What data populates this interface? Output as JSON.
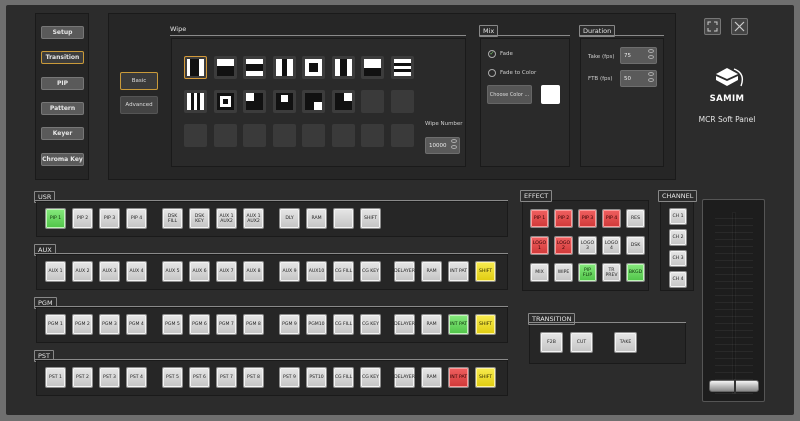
{
  "nav": [
    "Setup",
    "Transition",
    "PIP",
    "Pattern",
    "Keyer",
    "Chroma Key"
  ],
  "nav_active": 1,
  "wipe": {
    "title": "Wipe",
    "tabs": [
      "Basic",
      "Advanced"
    ],
    "number_label": "Wipe Number",
    "number_value": "10000"
  },
  "mix": {
    "title": "Mix",
    "fade": "Fade",
    "fade_to_color": "Fade to Color",
    "choose_color": "Choose Color ..."
  },
  "duration": {
    "title": "Duration",
    "take_label": "Take (fps)",
    "take_value": "75",
    "ftb_label": "FTB (fps)",
    "ftb_value": "50"
  },
  "brand": {
    "name": "SAMIM",
    "product": "MCR Soft Panel"
  },
  "usr": {
    "title": "USR",
    "buttons": [
      "PIP 1",
      "PIP 2",
      "PIP 3",
      "PIP 4",
      "DSK FILL",
      "DSK KEY",
      "AUX 1 AUX2",
      "AUX 1 AUX2",
      "DLY",
      "RAM",
      "",
      "SHIFT"
    ]
  },
  "aux": {
    "title": "AUX",
    "buttons": [
      "AUX 1",
      "AUX 2",
      "AUX 3",
      "AUX 4",
      "AUX 5",
      "AUX 6",
      "AUX 7",
      "AUX 8",
      "AUX 9",
      "AUX10",
      "CG FILL",
      "CG KEY",
      "DELAYER",
      "RAM",
      "INT PAT",
      "SHIFT"
    ]
  },
  "pgm": {
    "title": "PGM",
    "buttons": [
      "PGM 1",
      "PGM 2",
      "PGM 3",
      "PGM 4",
      "PGM 5",
      "PGM 6",
      "PGM 7",
      "PGM 8",
      "PGM 9",
      "PGM10",
      "CG FILL",
      "CG KEY",
      "DELAYER",
      "RAM",
      "INT PAT",
      "SHIFT"
    ]
  },
  "pst": {
    "title": "PST",
    "buttons": [
      "PST 1",
      "PST 2",
      "PST 3",
      "PST 4",
      "PST 5",
      "PST 6",
      "PST 7",
      "PST 8",
      "PST 9",
      "PST10",
      "CG FILL",
      "CG KEY",
      "DELAYER",
      "RAM",
      "INT PAT",
      "SHIFT"
    ]
  },
  "effect": {
    "title": "EFFECT",
    "row1": [
      "PIP 1",
      "PIP 2",
      "PIP 3",
      "PIP 4",
      "RES"
    ],
    "row2": [
      "LOGO 1",
      "LOGO 2",
      "LOGO 3",
      "LOGO 4",
      "DSK"
    ],
    "row3": [
      "MIX",
      "WIPE",
      "PIP FLIP",
      "TR PREV",
      "BKGD"
    ]
  },
  "channel": {
    "title": "CHANNEL",
    "buttons": [
      "CH 1",
      "CH 2",
      "CH 3",
      "CH 4"
    ]
  },
  "transition": {
    "title": "TRANSITION",
    "buttons": [
      "F2B",
      "CUT",
      "TAKE"
    ]
  },
  "colors": {
    "accent": "#c99a3a",
    "red": "#e04848",
    "green": "#62d25a",
    "yellow": "#ecd82e"
  },
  "icons": [
    "fullscreen-icon",
    "close-icon",
    "samim-logo-icon",
    "check-icon"
  ]
}
